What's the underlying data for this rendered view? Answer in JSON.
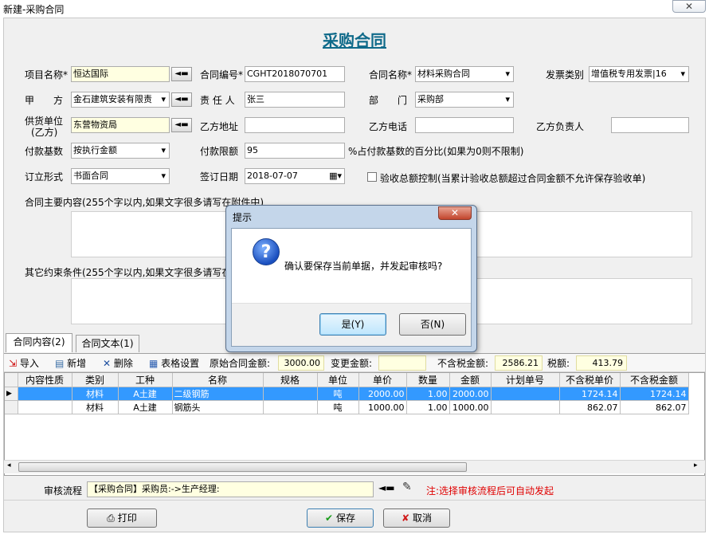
{
  "window": {
    "title": "新建-采购合同",
    "close": "✕"
  },
  "form": {
    "heading": "采购合同",
    "project_label": "项目名称*",
    "project_value": "恒达国际",
    "contract_no_label": "合同编号*",
    "contract_no_value": "CGHT2018070701",
    "contract_name_label": "合同名称*",
    "contract_name_value": "材料采购合同",
    "invoice_type_label": "发票类别",
    "invoice_type_value": "增值税专用发票|16",
    "party_a_label": "甲　　方",
    "party_a_value": "金石建筑安装有限责",
    "manager_label": "责 任 人",
    "manager_value": "张三",
    "dept_label": "部　　门",
    "dept_value": "采购部",
    "supplier_label_1": "供货单位",
    "supplier_label_2": "(乙方)",
    "supplier_value": "东营物资局",
    "b_addr_label": "乙方地址",
    "b_addr_value": "",
    "b_phone_label": "乙方电话",
    "b_phone_value": "",
    "b_owner_label": "乙方负责人",
    "b_owner_value": "",
    "pay_base_label": "付款基数",
    "pay_base_value": "按执行金额",
    "pay_limit_label": "付款限额",
    "pay_limit_value": "95",
    "pay_limit_note": "%占付款基数的百分比(如果为0则不限制)",
    "form_type_label": "订立形式",
    "form_type_value": "书面合同",
    "sign_date_label": "签订日期",
    "sign_date_value": "2018-07-07",
    "accept_check_label": "验收总额控制(当累计验收总额超过合同金额不允许保存验收单)",
    "main_content_label": "合同主要内容(255个字以内,如果文字很多请写在附件中)",
    "other_terms_label": "其它约束条件(255个字以内,如果文字很多请写在附件中)"
  },
  "tabs": [
    {
      "label": "合同内容(2)"
    },
    {
      "label": "合同文本(1)"
    }
  ],
  "toolbar": {
    "import": "导入",
    "add": "新增",
    "delete": "删除",
    "grid_setting": "表格设置",
    "orig_amount_label": "原始合同金额:",
    "orig_amount_value": "3000.00",
    "change_amount_label": "变更金额:",
    "change_amount_value": "",
    "no_tax_label": "不含税金额:",
    "no_tax_value": "2586.21",
    "tax_label": "税额:",
    "tax_value": "413.79"
  },
  "grid": {
    "columns": [
      "内容性质",
      "类别",
      "工种",
      "名称",
      "规格",
      "单位",
      "单价",
      "数量",
      "金额",
      "计划单号",
      "不含税单价",
      "不含税金额"
    ],
    "rows": [
      [
        "",
        "材料",
        "A土建",
        "二级钢筋",
        "",
        "吨",
        "2000.00",
        "1.00",
        "2000.00",
        "",
        "1724.14",
        "1724.14"
      ],
      [
        "",
        "材料",
        "A土建",
        "钢筋头",
        "",
        "吨",
        "1000.00",
        "1.00",
        "1000.00",
        "",
        "862.07",
        "862.07"
      ]
    ]
  },
  "approval": {
    "label": "审核流程",
    "value": "【采购合同】采购员:->生产经理:",
    "note": "注:选择审核流程后可自动发起"
  },
  "buttons": {
    "print": "打印",
    "save": "保存",
    "cancel": "取消"
  },
  "dialog": {
    "title": "提示",
    "message": "确认要保存当前单据，并发起审核吗?",
    "yes": "是(Y)",
    "no": "否(N)",
    "close": "✕"
  },
  "colors": {
    "heading": "#0f6a8a",
    "selection": "#3399ff",
    "note": "#e00000"
  }
}
